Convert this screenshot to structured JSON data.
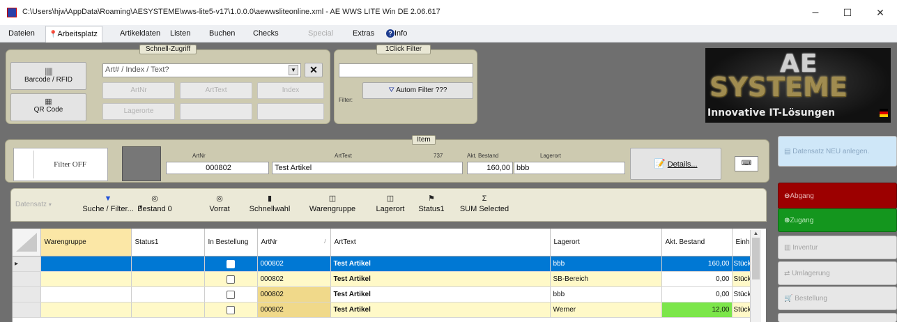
{
  "window": {
    "title": "C:\\Users\\hjw\\AppData\\Roaming\\AESYSTEME\\wws-lite5-v17\\1.0.0.0\\aewwsliteonline.xml - AE WWS LITE Win DE 2.06.617",
    "minimize": "–",
    "maximize": "☐",
    "close": "✕"
  },
  "menu": {
    "items": [
      "Dateien",
      "Arbeitsplatz",
      "Artikeldaten",
      "Listen",
      "Buchen",
      "Checks",
      "Special",
      "Extras",
      "Info"
    ]
  },
  "quick_access": {
    "title": "Schnell-Zugriff",
    "barcode_label": "Barcode / RFID",
    "qr_label": "QR Code",
    "search_placeholder": "Art# / Index / Text?",
    "buttons": [
      "ArtNr",
      "ArtText",
      "Index",
      "Lagerorte",
      "",
      ""
    ]
  },
  "oneclick": {
    "title": "1Click Filter",
    "input_value": "",
    "filter_label": "Filter:",
    "autom_button": "Autom Filter ???"
  },
  "logo": {
    "line1": "AE",
    "line2": "SYSTEME",
    "tagline": "Innovative IT-Lösungen"
  },
  "item": {
    "title": "Item",
    "filter_button": "Filter OFF",
    "artnr_label": "ArtNr",
    "arttext_label": "ArtText",
    "count": "737",
    "bestand_label": "Akt. Bestand",
    "lagerort_label": "Lagerort",
    "artnr": "000802",
    "arttext": "Test Artikel",
    "bestand": "160,00",
    "lagerort": "bbb",
    "details_button": "Details..."
  },
  "toolbar": {
    "datensatz": "Datensatz",
    "items": [
      {
        "icon": "▼",
        "label": "Suche / Filter..."
      },
      {
        "icon": "◎",
        "label": "Bestand 0"
      },
      {
        "icon": "◎",
        "label": "Vorrat"
      },
      {
        "icon": "▮",
        "label": "Schnellwahl"
      },
      {
        "icon": "◫",
        "label": "Warengruppe"
      },
      {
        "icon": "◫",
        "label": "Lagerort"
      },
      {
        "icon": "⚑",
        "label": "Status1"
      },
      {
        "icon": "Σ",
        "label": "SUM Selected"
      }
    ]
  },
  "grid": {
    "columns": [
      "Warengruppe",
      "Status1",
      "In Bestellung",
      "ArtNr",
      "ArtText",
      "Lagerort",
      "Akt. Bestand",
      "Einh"
    ],
    "rows": [
      {
        "marker": "▸",
        "warengruppe": "",
        "status1": "",
        "artnr": "000802",
        "arttext": "Test Artikel",
        "lagerort": "bbb",
        "bestand": "160,00",
        "einh": "Stück"
      },
      {
        "marker": "",
        "warengruppe": "",
        "status1": "",
        "artnr": "000802",
        "arttext": "Test Artikel",
        "lagerort": "SB-Bereich",
        "bestand": "0,00",
        "einh": "Stück"
      },
      {
        "marker": "",
        "warengruppe": "",
        "status1": "",
        "artnr": "000802",
        "arttext": "Test Artikel",
        "lagerort": "bbb",
        "bestand": "0,00",
        "einh": "Stück"
      },
      {
        "marker": "",
        "warengruppe": "",
        "status1": "",
        "artnr": "000802",
        "arttext": "Test Artikel",
        "lagerort": "Werner",
        "bestand": "12,00",
        "einh": "Stück"
      }
    ]
  },
  "right_panel": {
    "neu": "Datensatz NEU anlegen.",
    "abgang": "Abgang",
    "zugang": "Zugang",
    "inventur": "Inventur",
    "umlagerung": "Umlagerung",
    "bestellung": "Bestellung"
  },
  "colors": {
    "accent_blue": "#0078d4",
    "abgang_red": "#9c0000",
    "zugang_green": "#14961e",
    "highlight_green": "#7ce64a"
  }
}
